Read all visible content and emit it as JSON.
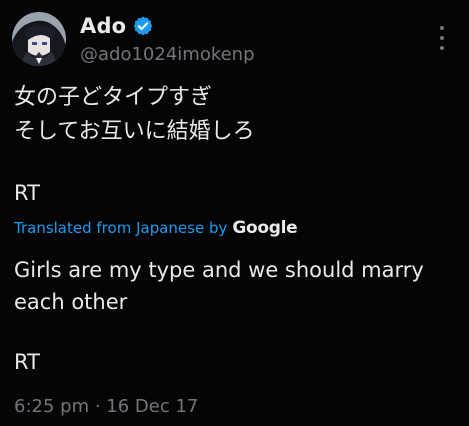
{
  "profile": {
    "display_name": "Ado",
    "handle": "@ado1024imokenp",
    "avatar_icon": "profile-avatar",
    "verified_icon": "verified-badge-icon",
    "verified_color": "#1d9bf0"
  },
  "menu": {
    "icon": "more-options-icon"
  },
  "tweet": {
    "original_text": "女の子どタイプすぎ\nそしてお互いに結婚しろ",
    "original_rt": "RT",
    "translated_prefix": "Translated from Japanese by",
    "translation_provider": "Google",
    "translated_text": "Girls are my type and we should marry each other",
    "translated_rt": "RT",
    "timestamp": "6:25 pm · 16 Dec 17"
  },
  "colors": {
    "background": "#050505",
    "text": "#e7e9ea",
    "muted": "#71767b",
    "link": "#1d9bf0"
  }
}
